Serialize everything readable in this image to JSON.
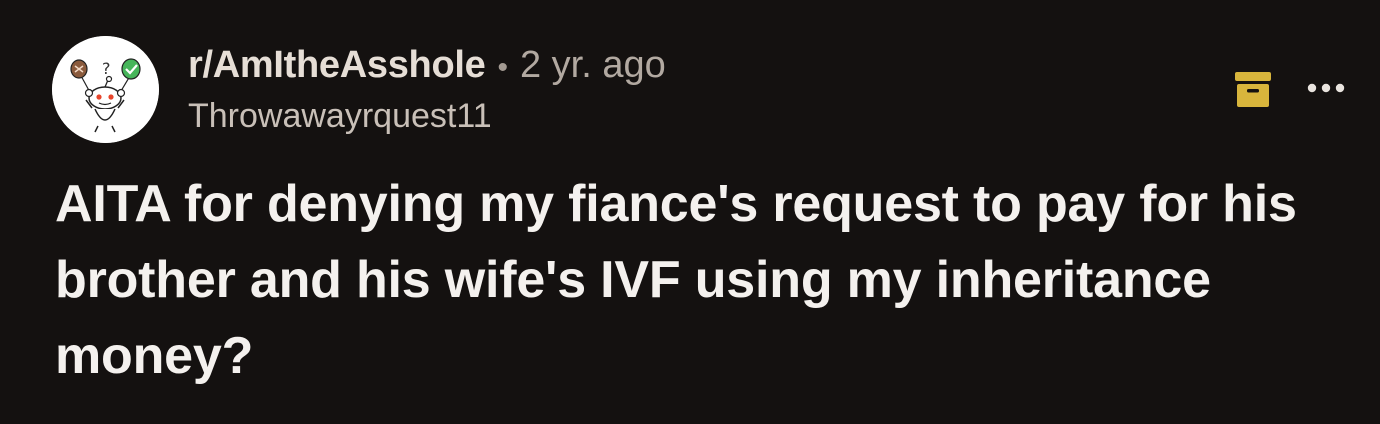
{
  "post": {
    "subreddit": "r/AmItheAsshole",
    "separator": "•",
    "age": "2 yr. ago",
    "author": "Throwawayrquest11",
    "title": "AITA for denying my fiance's request to pay for his brother and his wife's IVF using my inheritance money?"
  },
  "icons": {
    "avatar": "subreddit-avatar-icon",
    "save": "archive-box-icon",
    "more": "more-options-icon"
  },
  "colors": {
    "background": "#141110",
    "save_icon": "#d8b53c",
    "title_text": "#f4f1ee"
  }
}
